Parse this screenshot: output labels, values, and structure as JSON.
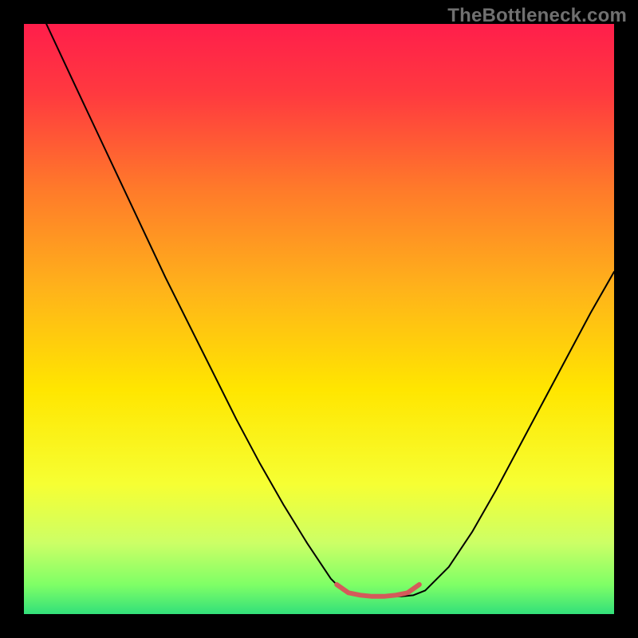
{
  "watermark": "TheBottleneck.com",
  "chart_data": {
    "type": "line",
    "title": "",
    "xlabel": "",
    "ylabel": "",
    "xlim": [
      0,
      100
    ],
    "ylim": [
      0,
      100
    ],
    "grid": false,
    "legend": false,
    "background_gradient": {
      "stops": [
        {
          "offset": 0.0,
          "color": "#ff1e4b"
        },
        {
          "offset": 0.12,
          "color": "#ff3a3f"
        },
        {
          "offset": 0.28,
          "color": "#ff7a2a"
        },
        {
          "offset": 0.45,
          "color": "#ffb31a"
        },
        {
          "offset": 0.62,
          "color": "#ffe600"
        },
        {
          "offset": 0.78,
          "color": "#f6ff33"
        },
        {
          "offset": 0.88,
          "color": "#ccff66"
        },
        {
          "offset": 0.95,
          "color": "#7fff66"
        },
        {
          "offset": 1.0,
          "color": "#33e07a"
        }
      ]
    },
    "series": [
      {
        "name": "bottleneck-curve",
        "stroke": "#000000",
        "stroke_width": 2,
        "x": [
          3.8,
          8,
          12,
          16,
          20,
          24,
          28,
          32,
          36,
          40,
          44,
          48,
          52,
          54,
          56,
          58,
          60,
          64,
          66,
          68,
          72,
          76,
          80,
          84,
          88,
          92,
          96,
          100
        ],
        "y": [
          100,
          91,
          82.5,
          74,
          65.5,
          57,
          49,
          41,
          33,
          25.5,
          18.5,
          12,
          6,
          4,
          3.2,
          3.0,
          3.0,
          3.0,
          3.2,
          4,
          8,
          14,
          21,
          28.5,
          36,
          43.5,
          51,
          58
        ]
      },
      {
        "name": "sweet-spot-marker",
        "stroke": "#d45a5a",
        "stroke_width": 6,
        "x": [
          53,
          55,
          57,
          59,
          61,
          63,
          65,
          67
        ],
        "y": [
          5.0,
          3.6,
          3.2,
          3.0,
          3.0,
          3.2,
          3.6,
          5.0
        ]
      }
    ]
  }
}
